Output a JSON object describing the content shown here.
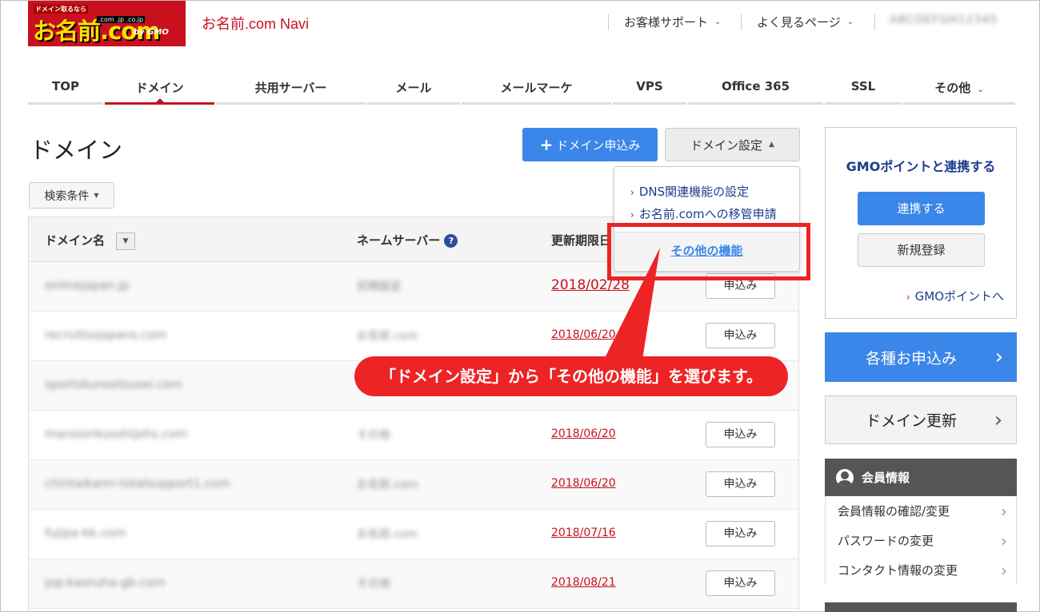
{
  "header": {
    "logo": {
      "tag": "ドメイン取るなら",
      "word": "お名前.com",
      "tlds": ".com .jp .co.jp",
      "by": "by GMO"
    },
    "navi_title": "お名前.com Navi",
    "support_label": "お客様サポート",
    "faq_label": "よく見るページ",
    "account_name": "ABCDEFGH12345"
  },
  "tabs": [
    "TOP",
    "ドメイン",
    "共用サーバー",
    "メール",
    "メールマーケ",
    "VPS",
    "Office 365",
    "SSL",
    "その他"
  ],
  "main": {
    "title": "ドメイン",
    "apply_button": "ドメイン申込み",
    "settings_button": "ドメイン設定",
    "search_button": "検索条件",
    "table": {
      "col_domain": "ドメイン名",
      "col_ns": "ネームサーバー",
      "col_expiry": "更新期限日",
      "apply_label": "申込み",
      "rows": [
        {
          "domain": "onlinejapan.jp",
          "ns": "初期設定",
          "date": "2018/02/28"
        },
        {
          "domain": "recruitsojapans.com",
          "ns": "お名前.com",
          "date": "2018/06/20"
        },
        {
          "domain": "sportskunsetsuzei.com",
          "ns": "",
          "date": ""
        },
        {
          "domain": "mansionkusshijohs.com",
          "ns": "その他",
          "date": "2018/06/20"
        },
        {
          "domain": "chintaikanri-totalsupport1.com",
          "ns": "お名前.com",
          "date": "2018/06/20"
        },
        {
          "domain": "fujipa-kk.com",
          "ns": "お名前.com",
          "date": "2018/07/16"
        },
        {
          "domain": "jop-kaoruha-gb.com",
          "ns": "その他",
          "date": "2018/08/21"
        }
      ]
    }
  },
  "dropdown": {
    "items": [
      "DNS関連機能の設定",
      "お名前.comへの移管申請"
    ],
    "other": "その他の機能"
  },
  "callout": "「ドメイン設定」から「その他の機能」を選びます。",
  "sidebar": {
    "gmo_title": "GMOポイントと連携する",
    "link_button": "連携する",
    "register_button": "新規登録",
    "gmo_link": "GMOポイントへ",
    "apply_big": "各種お申込み",
    "renew_big": "ドメイン更新",
    "member_title": "会員情報",
    "member_items": [
      "会員情報の確認/変更",
      "パスワードの変更",
      "コンタクト情報の変更"
    ]
  },
  "colors": {
    "brand_red": "#c8101e",
    "accent_blue": "#3a86e9",
    "callout_red": "#ec2426",
    "link_navy": "#1c3c8c"
  }
}
